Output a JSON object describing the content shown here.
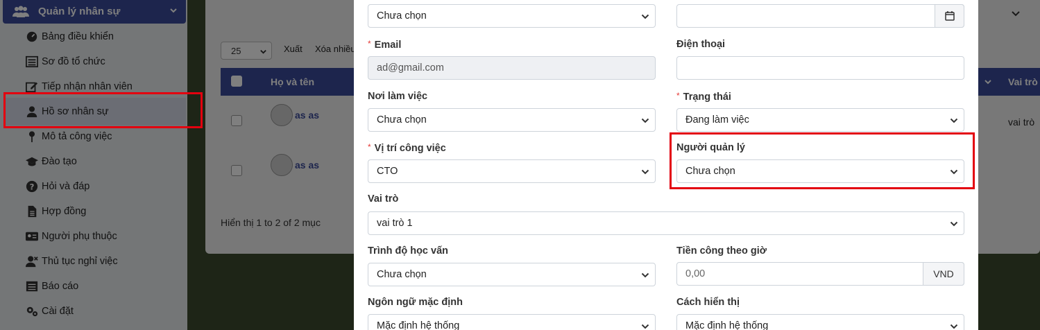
{
  "sidebar": {
    "group_label": "Quản lý nhân sự",
    "items": [
      {
        "label": "Bảng điều khiển",
        "icon": "dashboard-icon"
      },
      {
        "label": "Sơ đồ tổ chức",
        "icon": "list-icon"
      },
      {
        "label": "Tiếp nhận nhân viên",
        "icon": "edit-icon"
      },
      {
        "label": "Hồ sơ nhân sự",
        "icon": "user-icon"
      },
      {
        "label": "Mô tả công việc",
        "icon": "pin-icon"
      },
      {
        "label": "Đào tạo",
        "icon": "graduation-cap-icon"
      },
      {
        "label": "Hỏi và đáp",
        "icon": "question-icon"
      },
      {
        "label": "Hợp đồng",
        "icon": "file-icon"
      },
      {
        "label": "Người phụ thuộc",
        "icon": "id-card-icon"
      },
      {
        "label": "Thủ tục nghỉ việc",
        "icon": "user-times-icon"
      },
      {
        "label": "Báo cáo",
        "icon": "report-list-icon"
      },
      {
        "label": "Cài đặt",
        "icon": "gears-icon"
      }
    ]
  },
  "background": {
    "page_size": "25",
    "export_label": "Xuất",
    "bulk_delete_label": "Xóa nhiều",
    "col_name": "Họ và tên",
    "col_role": "Vai trò",
    "rows": [
      {
        "name": "as as",
        "role": "vai trò"
      },
      {
        "name": "as as",
        "role": ""
      }
    ],
    "footer": "Hiển thị 1 to 2 of 2 mục"
  },
  "form": {
    "top_left_select": "Chưa chọn",
    "top_right_date": "",
    "email_label": "Email",
    "email_value": "ad@gmail.com",
    "phone_label": "Điện thoại",
    "phone_value": "",
    "workplace_label": "Nơi làm việc",
    "workplace_value": "Chưa chọn",
    "status_label": "Trạng thái",
    "status_value": "Đang làm việc",
    "position_label": "Vị trí công việc",
    "position_value": "CTO",
    "manager_label": "Người quản lý",
    "manager_value": "Chưa chọn",
    "role_label": "Vai trò",
    "role_value": "vai trò 1",
    "education_label": "Trình độ học vấn",
    "education_value": "Chưa chọn",
    "hourly_label": "Tiền công theo giờ",
    "hourly_placeholder": "0,00",
    "hourly_currency": "VND",
    "language_label": "Ngôn ngữ mặc định",
    "language_value": "Mặc định hệ thống",
    "display_label": "Cách hiển thị",
    "display_value": "Mặc định hệ thống"
  },
  "colors": {
    "primary": "#3b4a9a",
    "highlight": "#e3000f",
    "required": "#e53935"
  }
}
